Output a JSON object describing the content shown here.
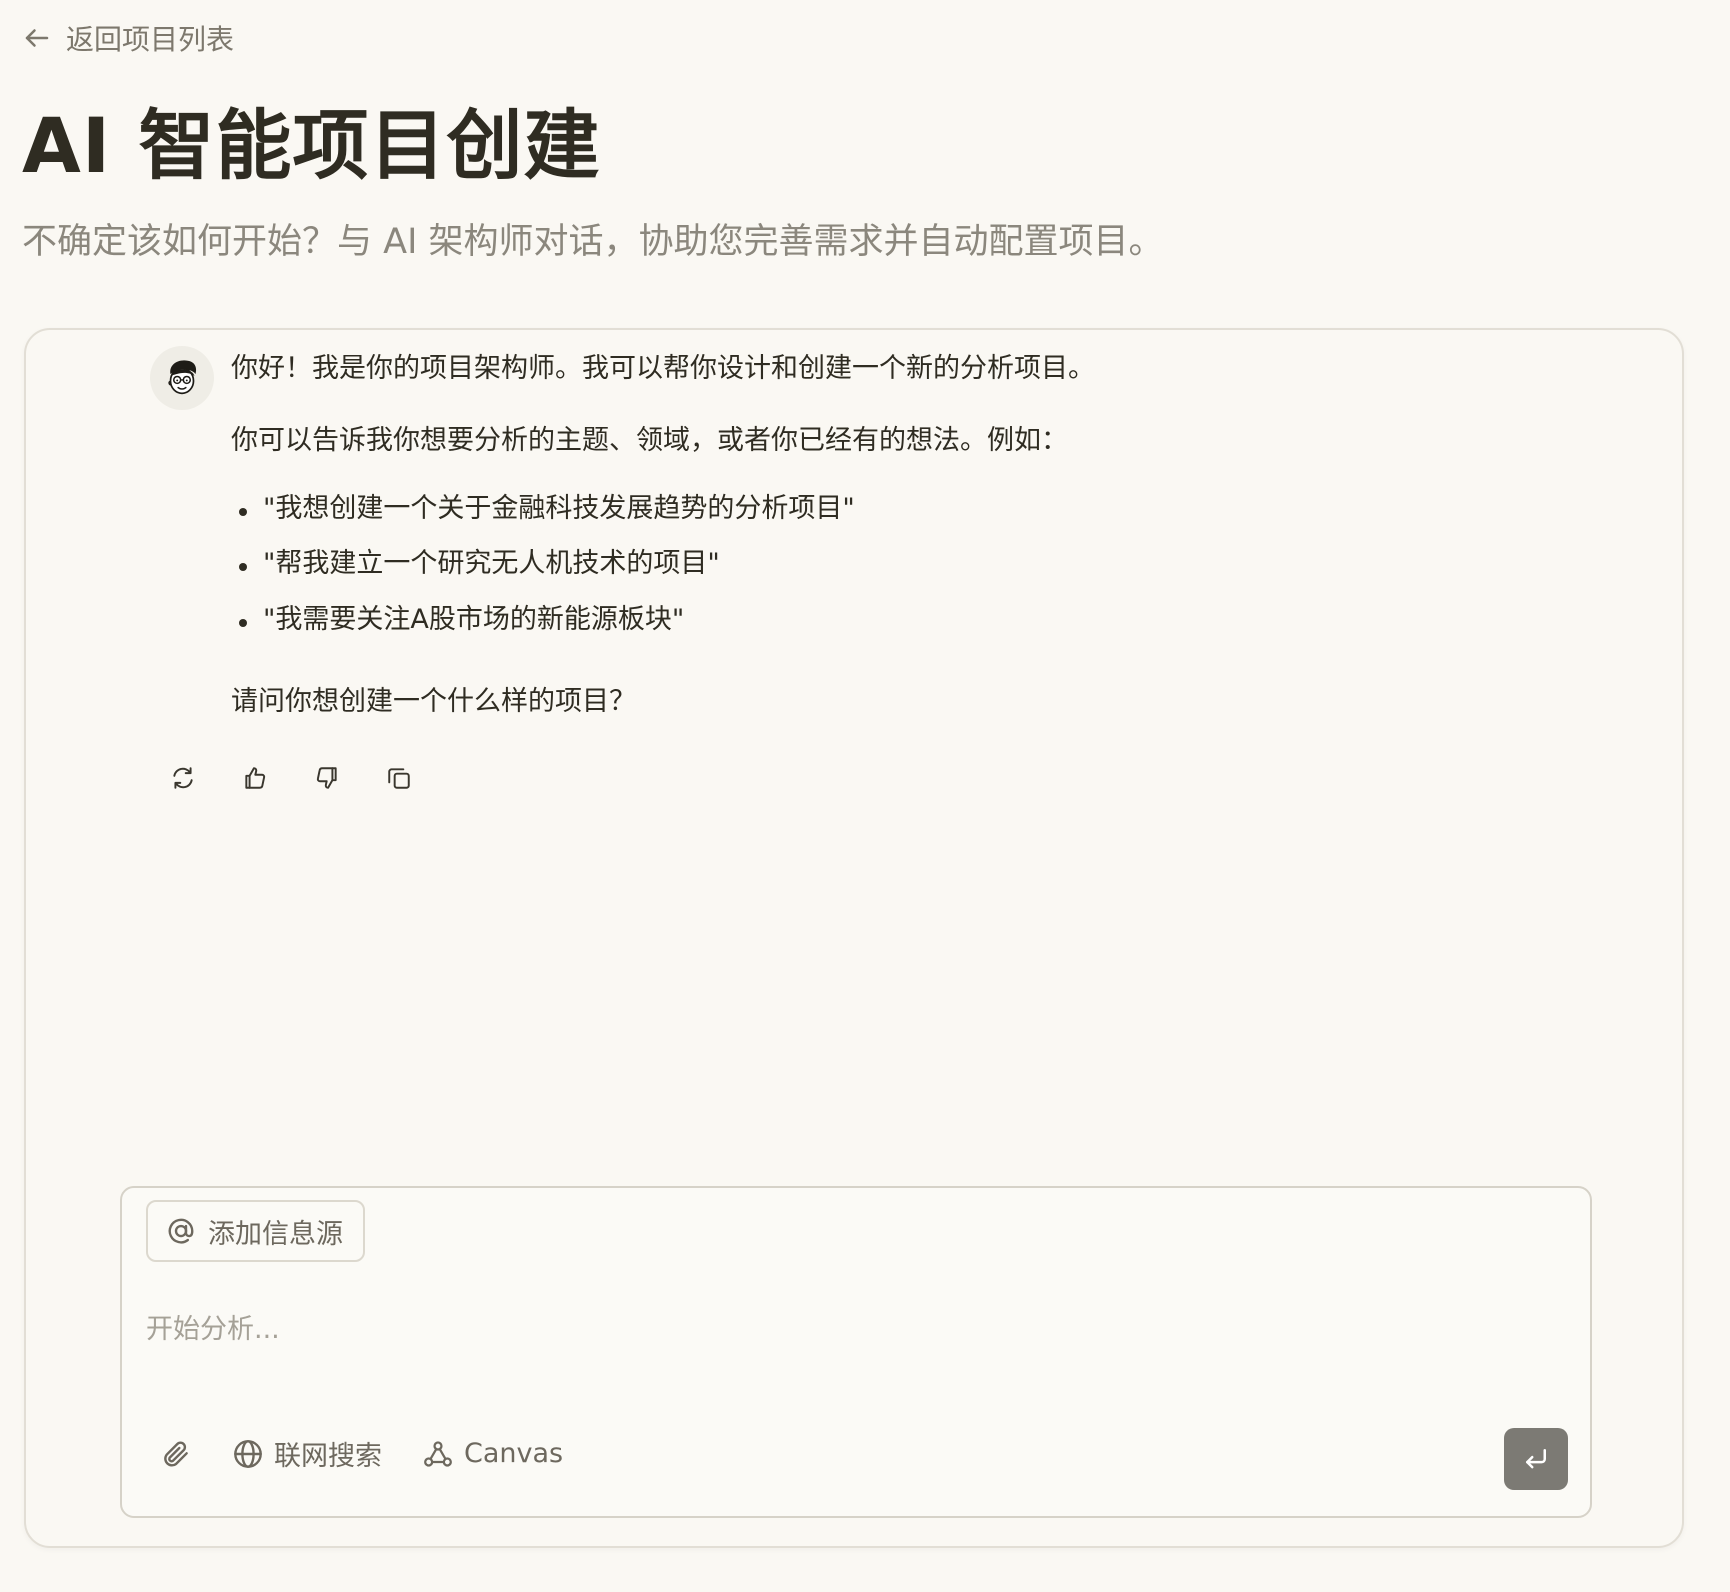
{
  "nav": {
    "back_label": "返回项目列表"
  },
  "header": {
    "title": "AI 智能项目创建",
    "subtitle": "不确定该如何开始？与 AI 架构师对话，协助您完善需求并自动配置项目。"
  },
  "message": {
    "greeting": "你好！我是你的项目架构师。我可以帮你设计和创建一个新的分析项目。",
    "intro": "你可以告诉我你想要分析的主题、领域，或者你已经有的想法。例如：",
    "examples": [
      "\"我想创建一个关于金融科技发展趋势的分析项目\"",
      "\"帮我建立一个研究无人机技术的项目\"",
      "\"我需要关注A股市场的新能源板块\""
    ],
    "question": "请问你想创建一个什么样的项目？"
  },
  "composer": {
    "add_source_label": "添加信息源",
    "placeholder": "开始分析...",
    "web_search_label": "联网搜索",
    "canvas_label": "Canvas"
  },
  "colors": {
    "background": "#faf8f3",
    "text": "#2f2c22",
    "muted": "#8b877d",
    "send_button": "#7c7a74"
  },
  "icons": {
    "back": "arrow-left-icon",
    "regenerate": "refresh-icon",
    "like": "thumbs-up-icon",
    "dislike": "thumbs-down-icon",
    "copy": "copy-icon",
    "mention": "at-sign-icon",
    "attach": "paperclip-icon",
    "web": "globe-icon",
    "canvas": "canvas-icon",
    "send": "enter-icon"
  }
}
